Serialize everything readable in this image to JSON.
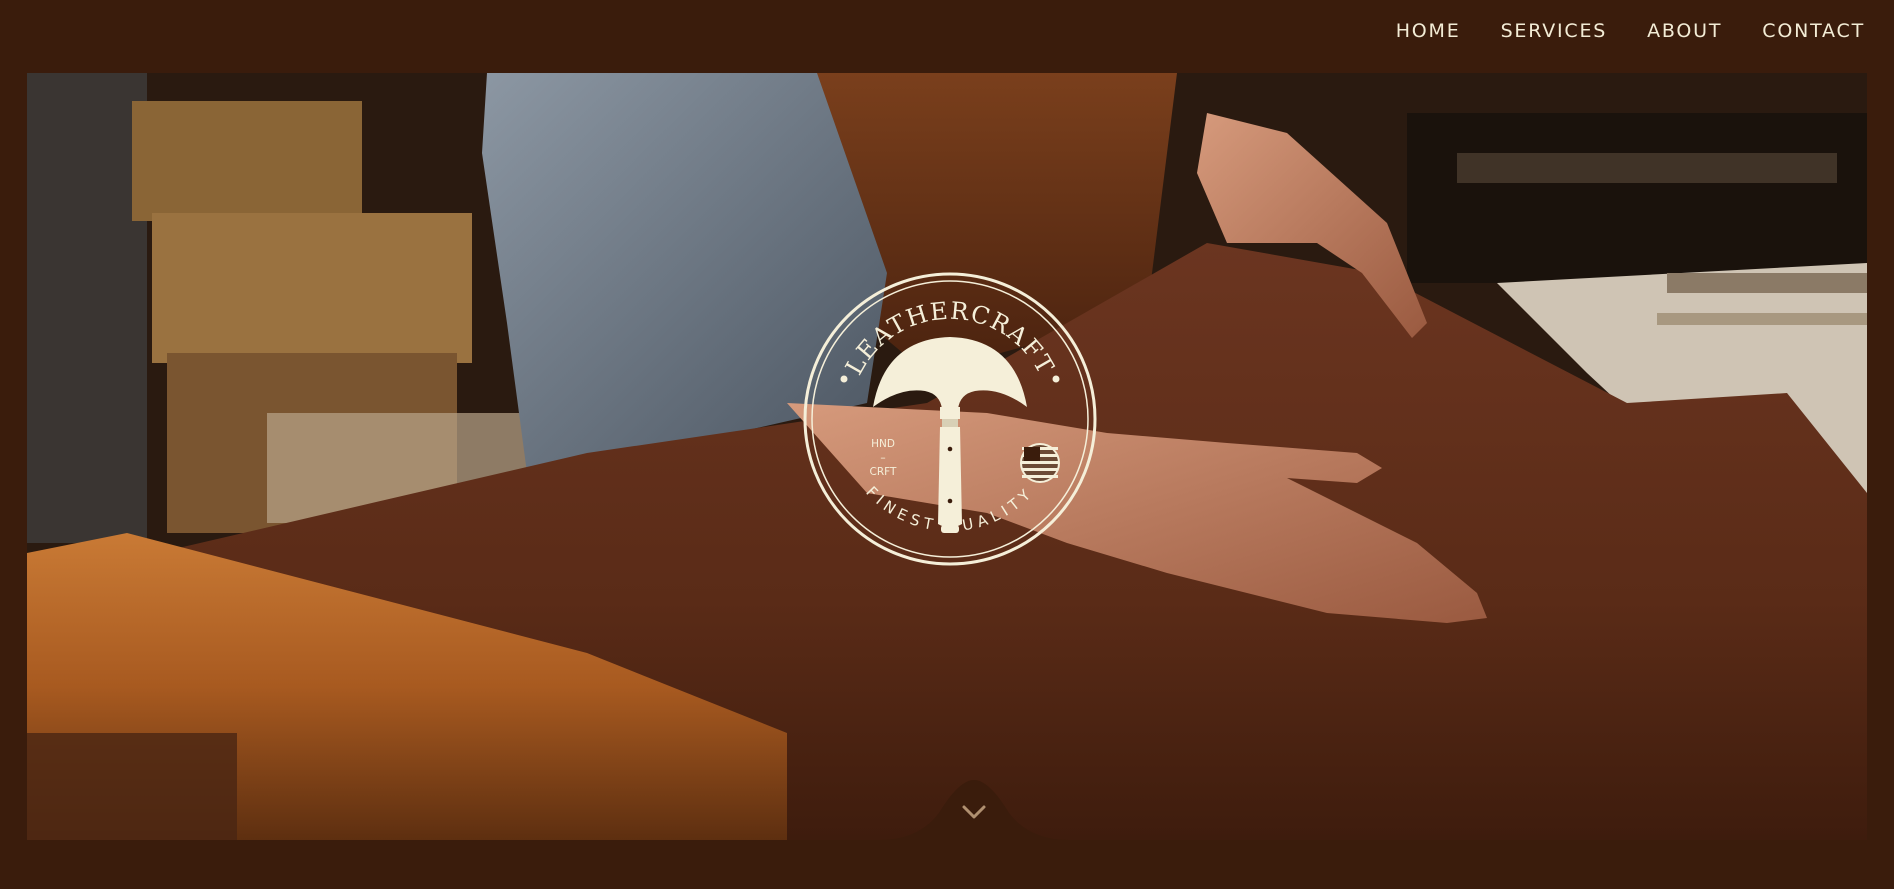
{
  "nav": {
    "items": [
      {
        "label": "HOME"
      },
      {
        "label": "SERVICES"
      },
      {
        "label": "ABOUT"
      },
      {
        "label": "CONTACT"
      }
    ]
  },
  "hero": {
    "emblem": {
      "brand": "LEATHERCRAFT",
      "tagline": "FINEST QUALITY",
      "mark_line1": "HND",
      "mark_line2": "–",
      "mark_line3": "CRFT",
      "icon": "leather-knife-icon",
      "flag_icon": "us-flag-icon"
    },
    "scroll_icon": "chevron-down-icon"
  },
  "colors": {
    "background": "#3a1c0c",
    "nav_text": "#f3ecd6",
    "emblem": "#f5efd9",
    "leather": "#5a2c17"
  }
}
